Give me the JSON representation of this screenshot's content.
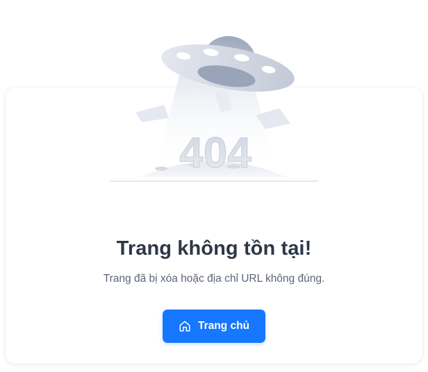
{
  "illustration": {
    "code": "404"
  },
  "main": {
    "title": "Trang không tồn tại!",
    "subtitle": "Trang đã bị xóa hoặc địa chỉ URL không đúng.",
    "home_button": {
      "label": "Trang chủ",
      "icon": "home-icon"
    }
  },
  "colors": {
    "accent": "#1677ff",
    "title": "#2d3748",
    "subtitle": "#5b6477"
  }
}
